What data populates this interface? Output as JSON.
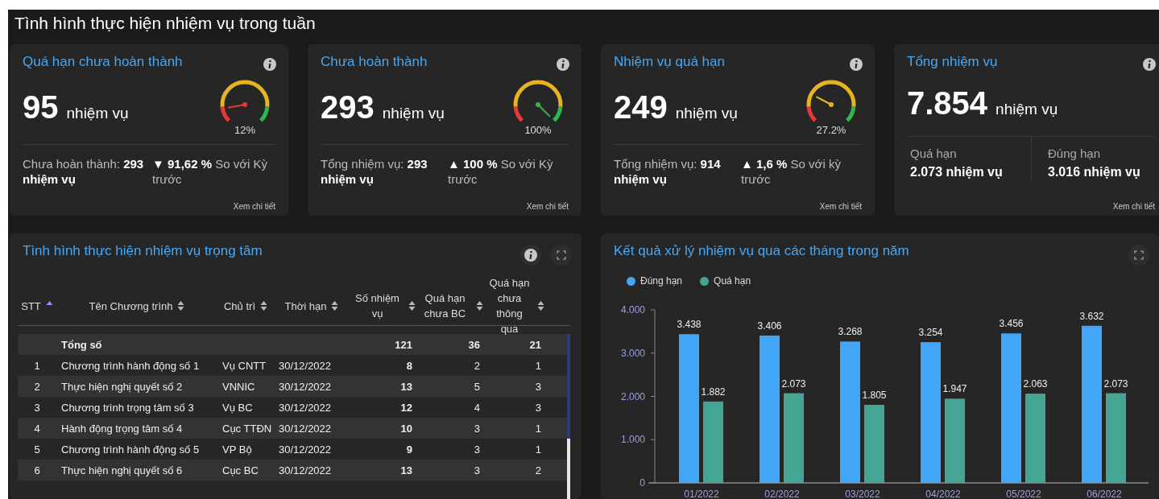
{
  "title": "Tình hình thực hiện nhiệm vụ trong tuần",
  "cards": [
    {
      "kind": "gauge",
      "title": "Quá hạn chưa hoàn thành",
      "value": "95",
      "unit": "nhiệm vụ",
      "percent": "12%",
      "detail": "Chưa hoàn thành: **293 nhiệm vụ**",
      "trend": "**▼ 91,62 %** So với Kỳ trước",
      "link": "Xem chi tiết"
    },
    {
      "kind": "gauge",
      "title": "Chưa hoàn thành",
      "value": "293",
      "unit": "nhiệm vụ",
      "percent": "100%",
      "detail": "Tổng nhiệm vụ: **293 nhiệm vụ**",
      "trend": "**▲ 100 %** So với Kỳ trước",
      "link": "Xem chi tiết"
    },
    {
      "kind": "gauge",
      "title": "Nhiệm vụ quá hạn",
      "value": "249",
      "unit": "nhiệm vụ",
      "percent": "27.2%",
      "detail": "Tổng nhiệm vụ: **914 nhiệm vụ**",
      "trend": "**▲ 1,6 %** So với kỳ trước",
      "link": "Xem chi tiết"
    },
    {
      "kind": "split",
      "title": "Tổng nhiệm vụ",
      "value": "7.854",
      "unit": "nhiệm vụ",
      "parts": [
        {
          "label": "Quá hạn",
          "value": "2.073 nhiệm vụ"
        },
        {
          "label": "Đúng hạn",
          "value": "3.016 nhiệm vụ"
        }
      ],
      "link": "Xem chi tiết"
    }
  ],
  "table_panel": {
    "title": "Tình hình thực hiện nhiệm vụ trọng tâm",
    "columns": [
      {
        "label": "STT",
        "sorted": true
      },
      {
        "label": "Tên Chương trình",
        "sorted": false
      },
      {
        "label": "Chủ trì",
        "sorted": false
      },
      {
        "label": "Thời hạn",
        "sorted": false
      },
      {
        "label": "Số nhiệm vụ",
        "sorted": false
      },
      {
        "label": "Quá hạn chưa BC",
        "sorted": false
      },
      {
        "label": "Quá hạn chưa thông qua",
        "sorted": false
      }
    ],
    "total": {
      "label": "Tổng số",
      "values": [
        "121",
        "36",
        "21"
      ]
    },
    "rows": [
      [
        "1",
        "Chương trình hành động số 1",
        "Vụ CNTT",
        "30/12/2022",
        "8",
        "2",
        "1"
      ],
      [
        "2",
        "Thực hiện nghị quyết số 2",
        "VNNIC",
        "30/12/2022",
        "13",
        "5",
        "3"
      ],
      [
        "3",
        "Chương trình trọng tâm số 3",
        "Vụ BC",
        "30/12/2022",
        "12",
        "4",
        "3"
      ],
      [
        "4",
        "Hành động trọng tâm số 4",
        "Cục TTĐN",
        "30/12/2022",
        "10",
        "3",
        "1"
      ],
      [
        "5",
        "Chương trình hành động số 5",
        "VP Bộ",
        "30/12/2022",
        "9",
        "3",
        "1"
      ],
      [
        "6",
        "Thực hiện nghị quyết số 6",
        "Cục BC",
        "30/12/2022",
        "13",
        "3",
        "2"
      ]
    ]
  },
  "chart_panel": {
    "title": "Kết quả xử lý nhiệm vụ qua các tháng trong năm",
    "chart_data": {
      "type": "bar",
      "categories": [
        "01/2022",
        "02/2022",
        "03/2022",
        "04/2022",
        "05/2022",
        "06/2022"
      ],
      "series": [
        {
          "name": "Đúng hạn",
          "color": "#42a5f5",
          "values": [
            3438,
            3406,
            3268,
            3254,
            3456,
            3632
          ]
        },
        {
          "name": "Quá hạn",
          "color": "#44a595",
          "values": [
            1882,
            2073,
            1805,
            1947,
            2063,
            2073
          ]
        }
      ],
      "ylim": [
        0,
        4000
      ],
      "yticks": [
        {
          "value": 0,
          "label": "0"
        },
        {
          "value": 1000,
          "label": "1.000"
        },
        {
          "value": 2000,
          "label": "2.000"
        },
        {
          "value": 3000,
          "label": "3.000"
        },
        {
          "value": 4000,
          "label": "4.000"
        }
      ],
      "value_labels": [
        [
          "3.438",
          "3.406",
          "3.268",
          "3.254",
          "3.456",
          "3.632"
        ],
        [
          "1.882",
          "2.073",
          "1.805",
          "1.947",
          "2.063",
          "2.073"
        ]
      ]
    }
  }
}
